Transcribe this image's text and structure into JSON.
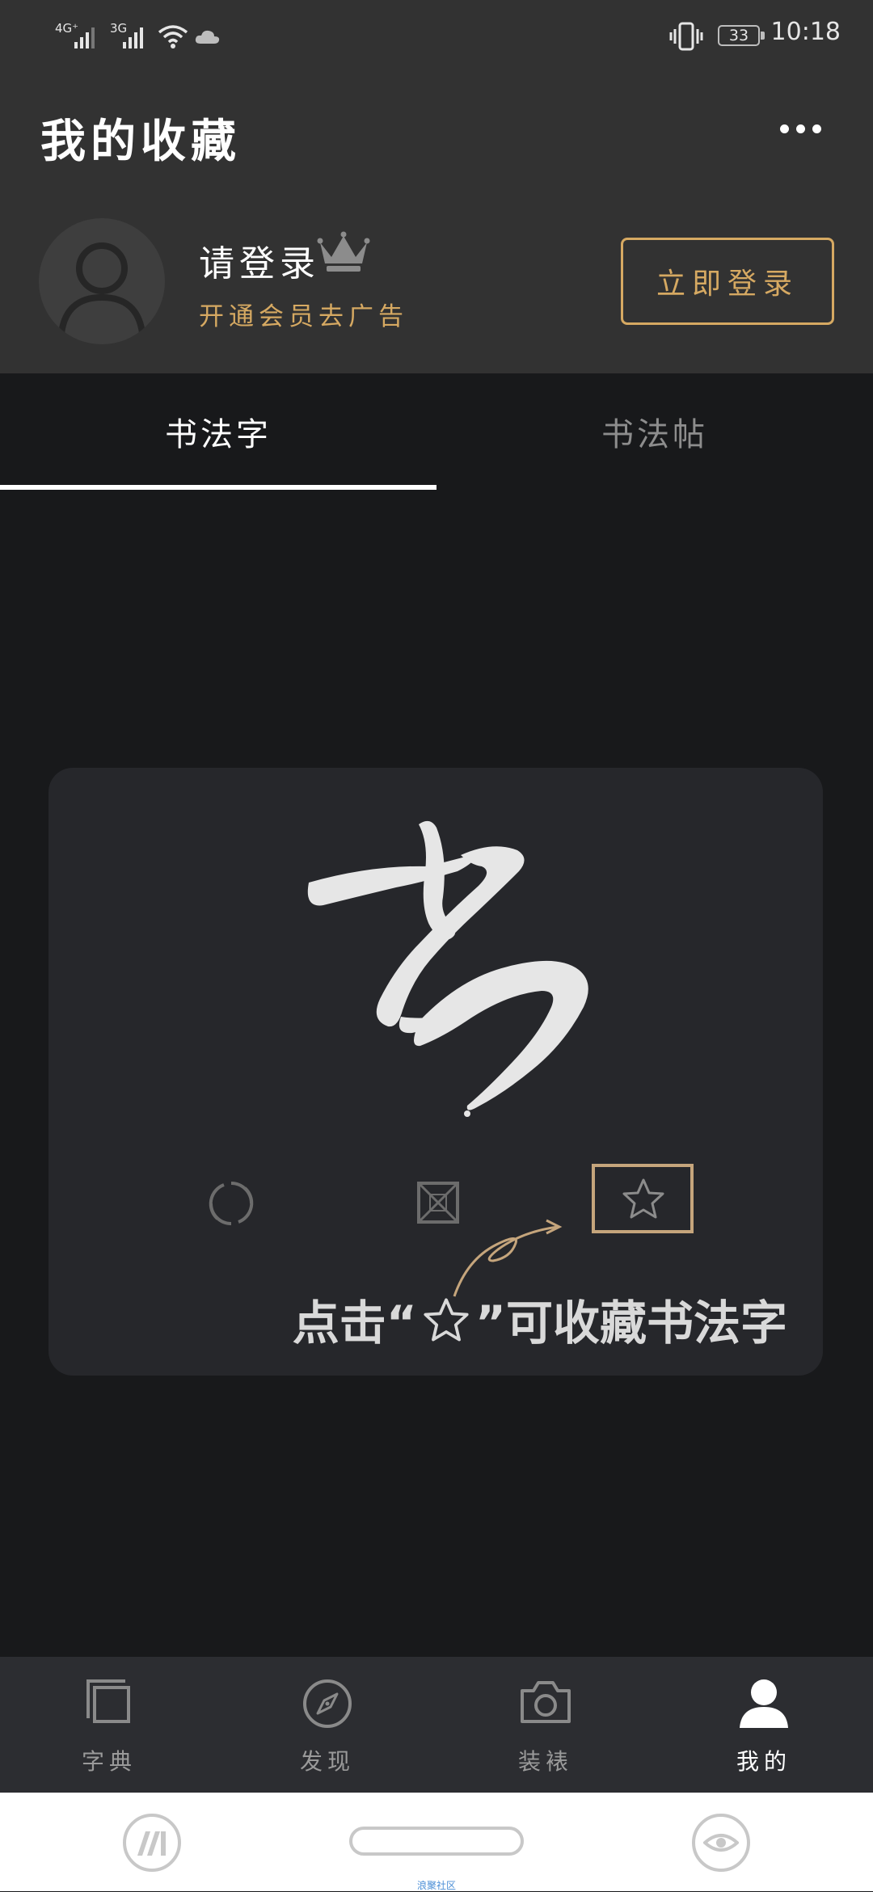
{
  "status_bar": {
    "net1": "4G⁺",
    "net2": "3G",
    "battery": "33",
    "time": "10:18"
  },
  "header": {
    "title": "我的收藏",
    "login_name": "请登录",
    "member_text": "开通会员去广告",
    "login_button": "立即登录",
    "accent_color": "#d6a962"
  },
  "tabs": [
    {
      "label": "书法字",
      "active": true
    },
    {
      "label": "书法帖",
      "active": false
    }
  ],
  "empty_state": {
    "hint_before": "点击“",
    "hint_after": "”可收藏书法字"
  },
  "bottom_nav": [
    {
      "label": "字典",
      "icon": "copy-icon",
      "active": false
    },
    {
      "label": "发现",
      "icon": "compass-icon",
      "active": false
    },
    {
      "label": "装裱",
      "icon": "camera-icon",
      "active": false
    },
    {
      "label": "我的",
      "icon": "user-icon",
      "active": true
    }
  ],
  "system_nav": {
    "watermark": "浪聚社区"
  }
}
